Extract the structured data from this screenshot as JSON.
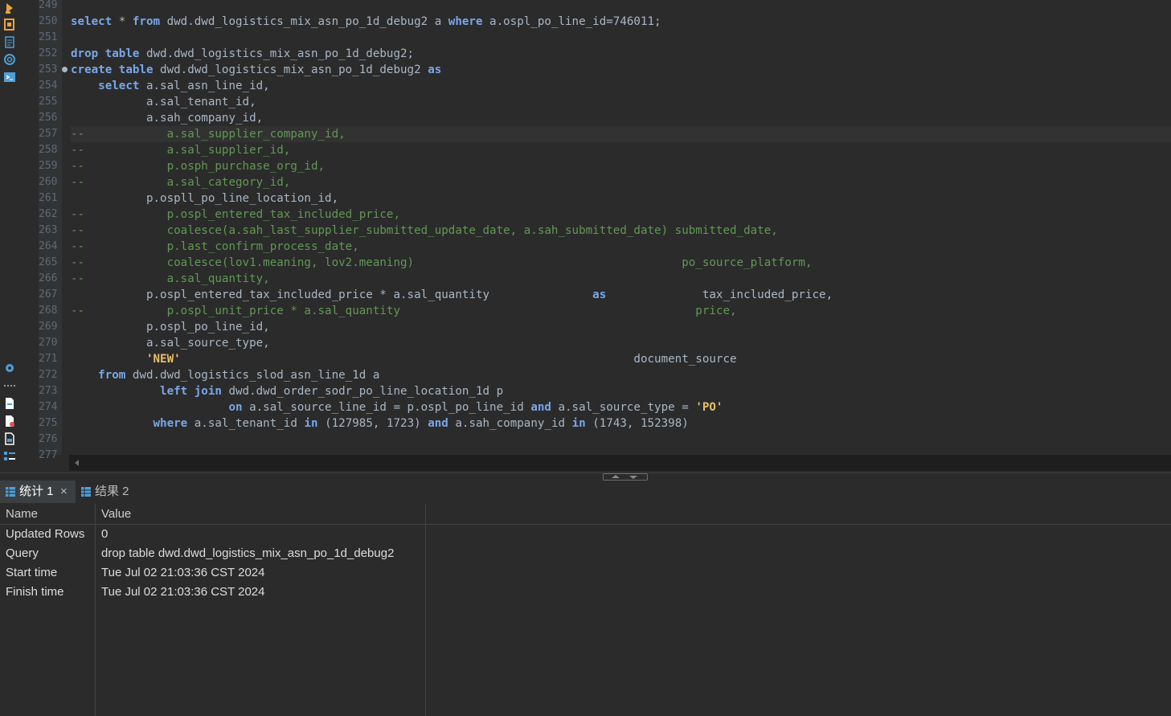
{
  "toolbar": {
    "icons": [
      "run-icon",
      "explain-icon",
      "format-icon",
      "openai-icon",
      "terminal-icon",
      "settings-icon",
      "more-icon",
      "export-icon",
      "import-icon",
      "file-icon",
      "outline-icon"
    ]
  },
  "editor": {
    "line_numbers": [
      "249",
      "250",
      "251",
      "252",
      "253",
      "254",
      "255",
      "256",
      "257",
      "258",
      "259",
      "260",
      "261",
      "262",
      "263",
      "264",
      "265",
      "266",
      "267",
      "268",
      "269",
      "270",
      "271",
      "272",
      "273",
      "274",
      "275",
      "276",
      "277"
    ],
    "highlighted_line": "257"
  },
  "results": {
    "tabs": [
      {
        "label": "统计 1",
        "active": true,
        "closable": true
      },
      {
        "label": "结果 2",
        "active": false,
        "closable": false
      }
    ],
    "columns": [
      "Name",
      "Value"
    ],
    "rows": [
      {
        "name": "Updated Rows",
        "value": "0"
      },
      {
        "name": "Query",
        "value": "drop table dwd.dwd_logistics_mix_asn_po_1d_debug2"
      },
      {
        "name": "Start time",
        "value": "Tue Jul 02 21:03:36 CST 2024"
      },
      {
        "name": "Finish time",
        "value": "Tue Jul 02 21:03:36 CST 2024"
      }
    ]
  },
  "colors": {
    "background": "#2b2b2b",
    "keyword": "#79a7e8",
    "comment": "#629755",
    "string": "#e8bf6a",
    "text": "#a9b7c6"
  }
}
